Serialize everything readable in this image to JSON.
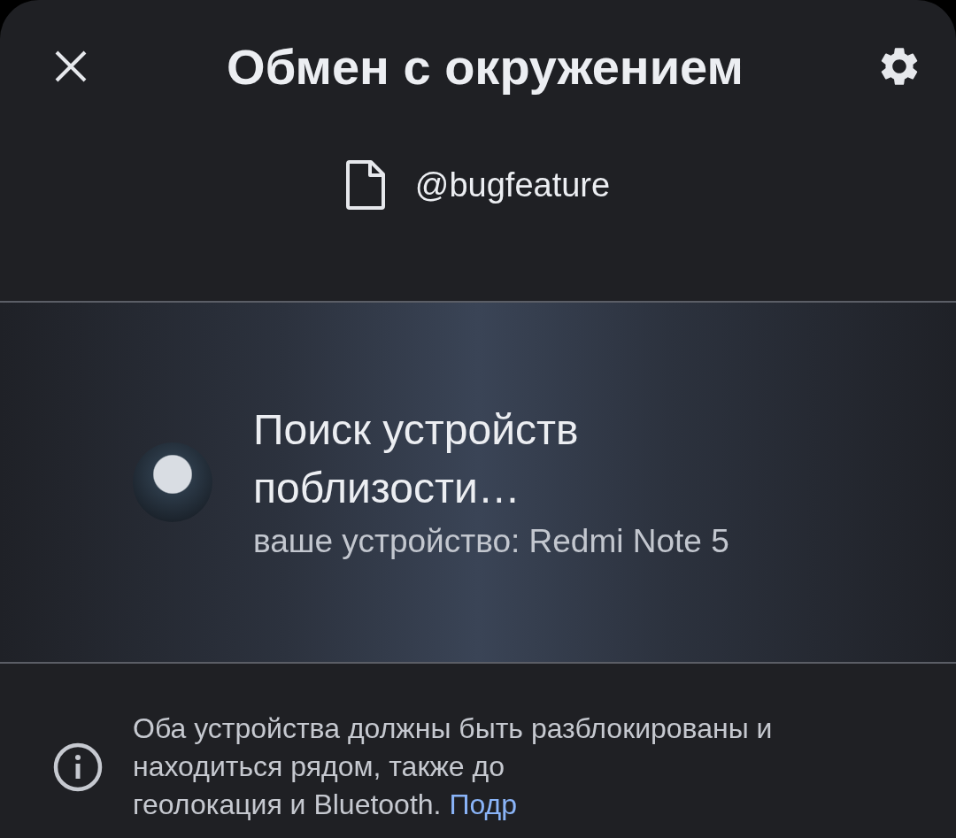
{
  "header": {
    "title": "Обмен с окружением"
  },
  "file": {
    "name": "@bugfeature"
  },
  "search": {
    "title": "Поиск устройств поблизости…",
    "subtitle": "ваше устройство: Redmi Note 5"
  },
  "info": {
    "lines": [
      "Оба устройства должны быть разблокированы и",
      "находиться рядом, также до",
      "геолокация и Bluetooth."
    ],
    "link": "Подр"
  }
}
